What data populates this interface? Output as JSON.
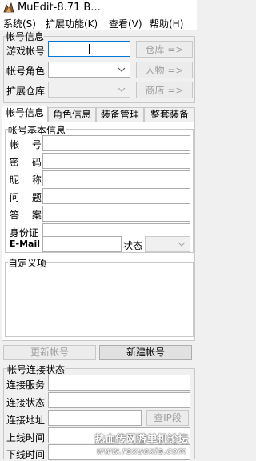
{
  "window": {
    "title": "MuEdit-8.71 B..."
  },
  "menu": [
    "系统(S)",
    "扩展功能(K)",
    "查看(V)",
    "帮助(H)"
  ],
  "account_info": {
    "group_title": "帐号信息",
    "game_account_label": "游戏帐号",
    "game_account_value": "",
    "account_role_label": "帐号角色",
    "ext_warehouse_label": "扩展仓库",
    "warehouse_button": "仓库 =>",
    "character_button": "人物 =>",
    "shop_button": "商店 =>"
  },
  "tabs": [
    "帐号信息",
    "角色信息",
    "装备管理",
    "整套装备"
  ],
  "basic_info": {
    "group_title": "帐号基本信息",
    "fields": [
      {
        "label": "帐  号",
        "value": ""
      },
      {
        "label": "密  码",
        "value": ""
      },
      {
        "label": "昵  称",
        "value": ""
      },
      {
        "label": "问  题",
        "value": ""
      },
      {
        "label": "答  案",
        "value": ""
      },
      {
        "label": "身份证",
        "value": ""
      }
    ],
    "email_label": "E-Mail",
    "email_value": "",
    "status_label": "状态",
    "custom_label": "自定义项"
  },
  "actions": {
    "update_button": "更新帐号",
    "new_button": "新建帐号"
  },
  "connection": {
    "group_title": "帐号连接状态",
    "service_label": "连接服务",
    "state_label": "连接状态",
    "address_label": "连接地址",
    "lookup_ip_button": "查IP段",
    "online_label": "上线时间",
    "offline_label": "下线时间"
  },
  "watermark": {
    "line1": "热血传网游单机论坛",
    "line2": "www.rexuexia.com"
  }
}
